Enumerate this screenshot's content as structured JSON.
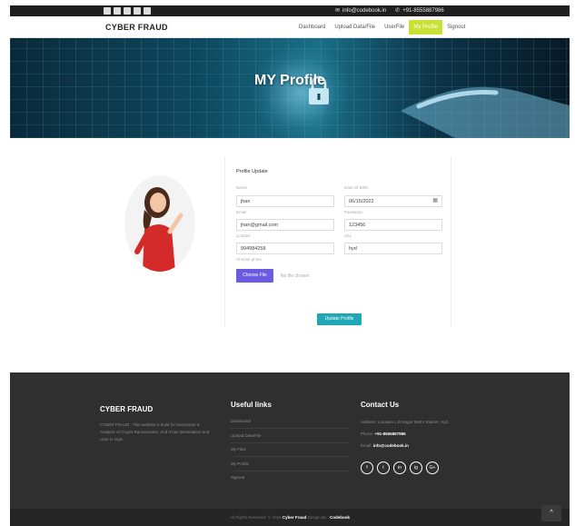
{
  "topbar": {
    "social_icons": [
      "facebook-icon",
      "instagram-icon",
      "linkedin-icon",
      "twitter-icon",
      "rss-icon"
    ],
    "email": "info@codebook.in",
    "phone": "+91-8555887986"
  },
  "navbar": {
    "brand": "CYBER FRAUD",
    "items": [
      {
        "label": "Dashboard"
      },
      {
        "label": "Upload Data/File"
      },
      {
        "label": "UserFile"
      },
      {
        "label": "My Profile"
      },
      {
        "label": "Signout"
      }
    ],
    "active_color": "#c7e235"
  },
  "hero": {
    "title": "MY Profile"
  },
  "profile": {
    "heading": "Profile Update",
    "name_label": "Name",
    "name_value": "jhan",
    "dob_label": "Date Of Birth",
    "dob_value": "06/15/2022",
    "email_label": "Email",
    "email_value": "jhan@gmail.com",
    "password_label": "Password",
    "password_value": "123456",
    "contact_label": "Contact",
    "contact_value": "994984258",
    "city_label": "City",
    "city_value": "hyd",
    "photo_label": "Choose photo",
    "file_button": "Choose File",
    "no_file": "No file chosen",
    "update_button": "Update Profile",
    "file_button_color": "#6a5be2",
    "update_button_color": "#1fa7b5"
  },
  "footer": {
    "brand": "CYBER FRAUD",
    "description": "CYBER FRAUD - This website is build for Dectection & Analysis of Crypto Ransomware. And It has Workstation and User to login.",
    "useful_heading": "Useful links",
    "links": [
      "Dashboard",
      "Upload Data/File",
      "My Files",
      "My Profile",
      "Signout"
    ],
    "contact_heading": "Contact Us",
    "address": "Address: Location L.B Nagar Metro Station, Hyd.",
    "phone_label": "Phone:",
    "phone": "+91-8555887986",
    "email_label": "Email:",
    "email": "info@codebook.in",
    "social": [
      "f",
      "t",
      "in",
      "ig",
      "G+"
    ]
  },
  "bottom": {
    "copy_prefix": "All Rights Reserved. © 2018",
    "site": "Cyber Fraud",
    "design_by": "Design By :",
    "designer": "Codebook"
  }
}
